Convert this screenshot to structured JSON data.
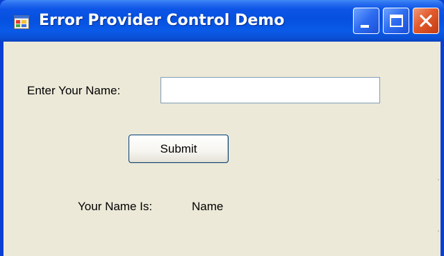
{
  "window": {
    "title": "Error Provider Control Demo",
    "colors": {
      "titlebar": "#0650df",
      "client_background": "#ece9d8",
      "close_button": "#e25a2c",
      "input_border": "#7f9db9"
    },
    "icons": [
      "app-icon",
      "minimize-icon",
      "maximize-icon",
      "close-icon"
    ]
  },
  "form": {
    "name_prompt": "Enter Your Name:",
    "name_input": {
      "value": "",
      "placeholder": ""
    },
    "submit_label": "Submit",
    "result_label": "Your Name Is:",
    "result_value": "Name"
  }
}
